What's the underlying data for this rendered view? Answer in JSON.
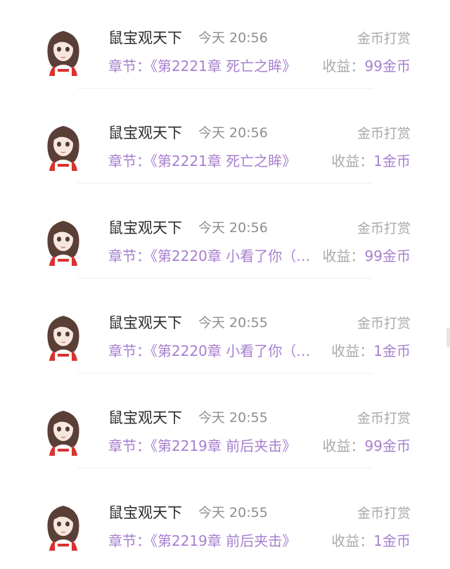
{
  "records": [
    {
      "user": "鼠宝观天下",
      "time": "今天 20:56",
      "type": "金币打赏",
      "chapter": "章节：《第2221章 死亡之眸》",
      "earn_label": "收益：",
      "earn_value": "99金币"
    },
    {
      "user": "鼠宝观天下",
      "time": "今天 20:56",
      "type": "金币打赏",
      "chapter": "章节：《第2221章 死亡之眸》",
      "earn_label": "收益：",
      "earn_value": "1金币"
    },
    {
      "user": "鼠宝观天下",
      "time": "今天 20:56",
      "type": "金币打赏",
      "chapter": "章节：《第2220章 小看了你（…",
      "earn_label": "收益：",
      "earn_value": "99金币"
    },
    {
      "user": "鼠宝观天下",
      "time": "今天 20:55",
      "type": "金币打赏",
      "chapter": "章节：《第2220章 小看了你（…",
      "earn_label": "收益：",
      "earn_value": "1金币"
    },
    {
      "user": "鼠宝观天下",
      "time": "今天 20:55",
      "type": "金币打赏",
      "chapter": "章节：《第2219章 前后夹击》",
      "earn_label": "收益：",
      "earn_value": "99金币"
    },
    {
      "user": "鼠宝观天下",
      "time": "今天 20:55",
      "type": "金币打赏",
      "chapter": "章节：《第2219章 前后夹击》",
      "earn_label": "收益：",
      "earn_value": "1金币"
    }
  ],
  "colors": {
    "accent": "#a77fcf",
    "muted": "#a9a9a9",
    "text": "#2b2b2b"
  },
  "icons": {
    "avatar": "girl-avatar-icon"
  }
}
